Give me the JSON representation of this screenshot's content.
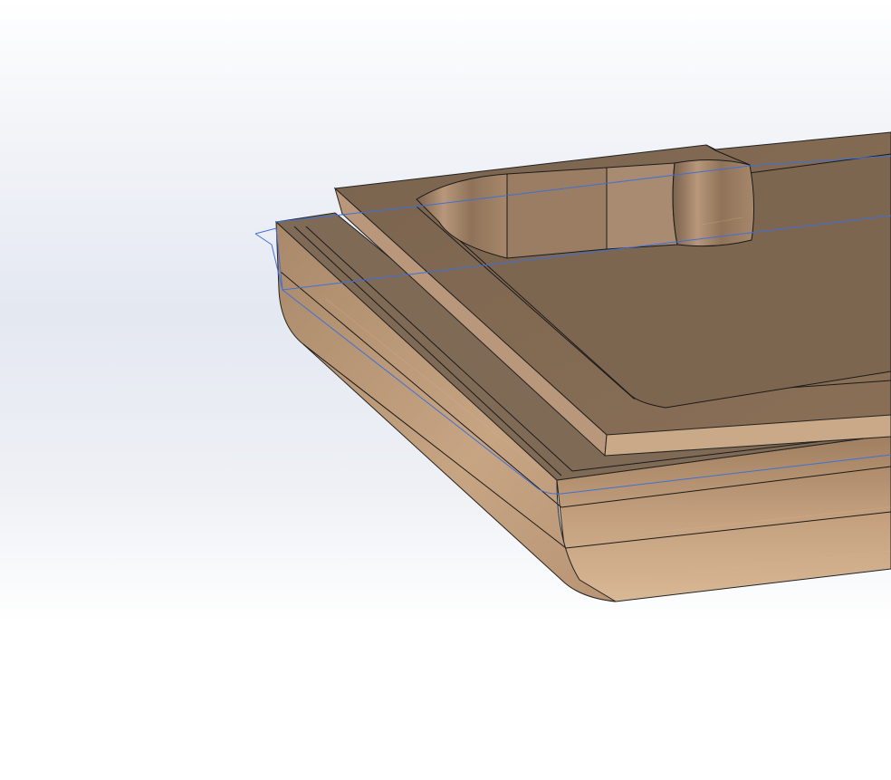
{
  "scene": {
    "type": "cad-3d-viewport",
    "background_top": "#ffffff",
    "background_mid": "#e4e8f1",
    "background_bottom": "#ffffff",
    "material": "wood (maple)",
    "wood_light": "#c8a27c",
    "wood_mid": "#9c7b5c",
    "wood_dark": "#6f5a48",
    "edge_color": "#1a1a1a",
    "highlight_sketch_color": "#3f6fd8"
  }
}
